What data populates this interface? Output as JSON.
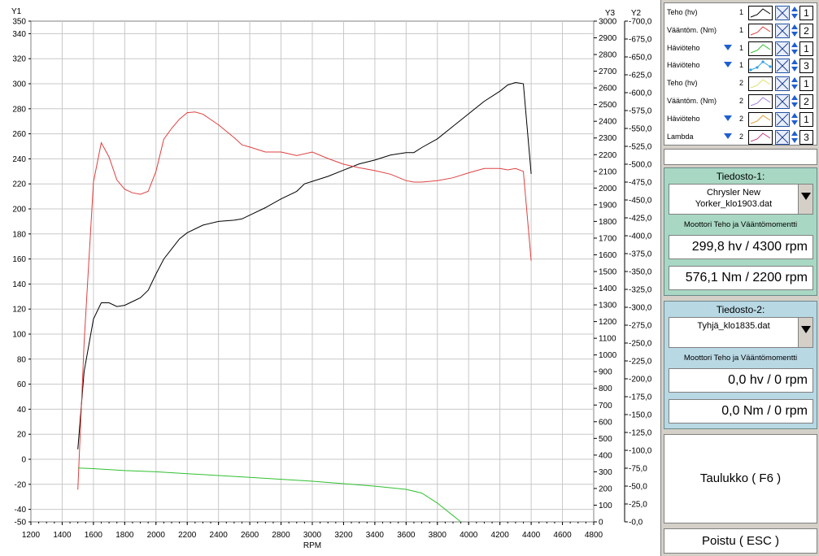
{
  "legend": [
    {
      "name": "Teho (hv)",
      "file": "1",
      "color": "#000000",
      "has_marker": false,
      "swatch": "line",
      "axis": "1"
    },
    {
      "name": "Vääntöm. (Nm)",
      "file": "1",
      "color": "#e04040",
      "has_marker": false,
      "swatch": "line",
      "axis": "2"
    },
    {
      "name": "Häviöteho",
      "file": "1",
      "color": "#30c030",
      "has_marker": true,
      "swatch": "line",
      "axis": "1"
    },
    {
      "name": "Häviöteho",
      "file": "1",
      "color": "#30a0e0",
      "has_marker": true,
      "swatch": "dots",
      "axis": "3"
    },
    {
      "name": "Teho (hv)",
      "file": "2",
      "color": "#e0e070",
      "has_marker": false,
      "swatch": "line",
      "axis": "1"
    },
    {
      "name": "Vääntöm. (Nm)",
      "file": "2",
      "color": "#a080e0",
      "has_marker": false,
      "swatch": "line",
      "axis": "2"
    },
    {
      "name": "Häviöteho",
      "file": "2",
      "color": "#e0a030",
      "has_marker": true,
      "swatch": "line",
      "axis": "1"
    },
    {
      "name": "Lambda",
      "file": "2",
      "color": "#c04080",
      "has_marker": true,
      "swatch": "line",
      "axis": "3"
    }
  ],
  "file1": {
    "title": "Tiedosto-1:",
    "filename_line1": "Chrysler New",
    "filename_line2": "Yorker_klo1903.dat",
    "subtitle": "Moottori Teho ja Vääntömomentti",
    "power": "299,8 hv / 4300 rpm",
    "torque": "576,1 Nm / 2200 rpm"
  },
  "file2": {
    "title": "Tiedosto-2:",
    "filename_line1": "Tyhjä_klo1835.dat",
    "filename_line2": "",
    "subtitle": "Moottori Teho ja Vääntömomentti",
    "power": "0,0 hv / 0 rpm",
    "torque": "0,0 Nm / 0 rpm"
  },
  "buttons": {
    "table": "Taulukko ( F6 )",
    "exit": "Poistu ( ESC )"
  },
  "chart_data": {
    "type": "line",
    "xlabel": "RPM",
    "y1_label": "Y1",
    "y2_label": "Y2",
    "y3_label": "Y3",
    "xlim": [
      1200,
      4800
    ],
    "y1lim": [
      -50,
      350
    ],
    "y2lim": [
      0,
      -700
    ],
    "y3lim": [
      0,
      3000
    ],
    "x_ticks": [
      "1200",
      "1400",
      "1600",
      "1800",
      "2000",
      "2200",
      "2400",
      "2600",
      "2800",
      "3000",
      "3200",
      "3400",
      "3600",
      "3800",
      "4000",
      "4200",
      "4400",
      "4600",
      "4800"
    ],
    "y1_ticks": [
      "-50",
      "-40",
      "-20",
      "0",
      "20",
      "40",
      "60",
      "80",
      "100",
      "120",
      "140",
      "160",
      "180",
      "200",
      "220",
      "240",
      "260",
      "280",
      "300",
      "320",
      "340",
      "350"
    ],
    "y2_ticks": [
      "-0,0",
      "-25,0",
      "-50,0",
      "-75,0",
      "-100,0",
      "-125,0",
      "-150,0",
      "-175,0",
      "-200,0",
      "-225,0",
      "-250,0",
      "-275,0",
      "-300,0",
      "-325,0",
      "-350,0",
      "-375,0",
      "-400,0",
      "-425,0",
      "-450,0",
      "-475,0",
      "-500,0",
      "-525,0",
      "-550,0",
      "-575,0",
      "-600,0",
      "-625,0",
      "-650,0",
      "-675,0",
      "-700,0"
    ],
    "y3_ticks": [
      "0",
      "100",
      "200",
      "300",
      "400",
      "500",
      "600",
      "700",
      "800",
      "900",
      "1000",
      "1100",
      "1200",
      "1300",
      "1400",
      "1500",
      "1600",
      "1700",
      "1800",
      "1900",
      "2000",
      "2100",
      "2200",
      "2300",
      "2400",
      "2500",
      "2600",
      "2700",
      "2800",
      "2900",
      "3000"
    ],
    "grid": true,
    "series": [
      {
        "name": "Teho (hv)",
        "axis": "y1",
        "color": "#000000",
        "x": [
          1500,
          1540,
          1600,
          1650,
          1700,
          1750,
          1800,
          1850,
          1900,
          1950,
          2000,
          2050,
          2100,
          2150,
          2200,
          2300,
          2400,
          2500,
          2550,
          2600,
          2700,
          2800,
          2900,
          2950,
          3000,
          3100,
          3200,
          3300,
          3400,
          3500,
          3600,
          3650,
          3700,
          3800,
          3900,
          4000,
          4100,
          4200,
          4250,
          4300,
          4350,
          4400
        ],
        "y": [
          8,
          70,
          112,
          125,
          125,
          122,
          123,
          126,
          129,
          135,
          148,
          160,
          168,
          176,
          181,
          187,
          190,
          191,
          192,
          195,
          201,
          208,
          214,
          220,
          222,
          226,
          231,
          236,
          239,
          243,
          245,
          245,
          249,
          256,
          266,
          276,
          286,
          294,
          299,
          301,
          300,
          228
        ]
      },
      {
        "name": "Vääntöm. (Nm)",
        "axis": "y2",
        "color": "#e04040",
        "x": [
          1500,
          1540,
          1600,
          1650,
          1700,
          1750,
          1800,
          1850,
          1900,
          1950,
          2000,
          2050,
          2100,
          2150,
          2200,
          2250,
          2300,
          2400,
          2500,
          2550,
          2600,
          2700,
          2800,
          2900,
          3000,
          3100,
          3200,
          3300,
          3400,
          3500,
          3600,
          3650,
          3700,
          3800,
          3900,
          4000,
          4100,
          4200,
          4250,
          4300,
          4350,
          4400
        ],
        "y": [
          -45,
          -250,
          -475,
          -530,
          -510,
          -478,
          -465,
          -460,
          -458,
          -462,
          -490,
          -535,
          -550,
          -563,
          -572,
          -573,
          -570,
          -555,
          -537,
          -527,
          -524,
          -517,
          -517,
          -512,
          -517,
          -508,
          -500,
          -495,
          -491,
          -486,
          -477,
          -475,
          -475,
          -477,
          -481,
          -488,
          -494,
          -494,
          -492,
          -494,
          -490,
          -365
        ]
      },
      {
        "name": "Häviöteho",
        "axis": "y1",
        "color": "#30c030",
        "x": [
          1500,
          1600,
          1800,
          2000,
          2200,
          2400,
          2600,
          2800,
          3000,
          3200,
          3400,
          3600,
          3700,
          3800,
          3900,
          3950
        ],
        "y": [
          -7,
          -7.5,
          -9,
          -10,
          -11.5,
          -13,
          -14.5,
          -16,
          -17.5,
          -19.5,
          -21.5,
          -24,
          -27,
          -35,
          -45,
          -50
        ]
      }
    ]
  }
}
